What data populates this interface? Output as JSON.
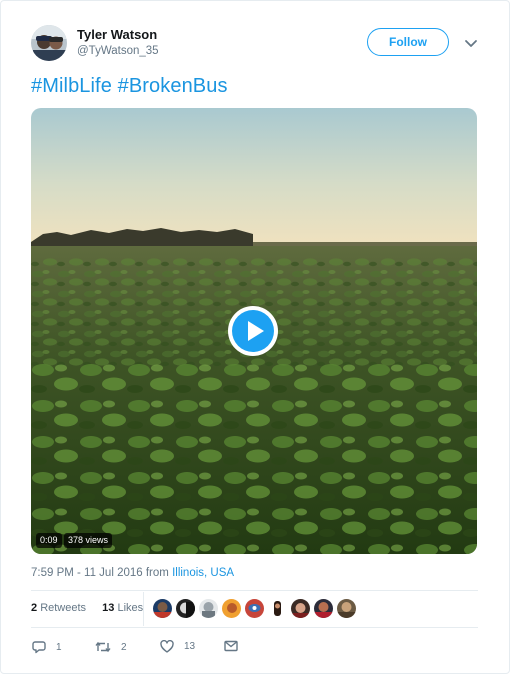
{
  "author": {
    "name": "Tyler Watson",
    "handle": "@TyWatson_35"
  },
  "follow_label": "Follow",
  "tweet_text": "#MilbLife #BrokenBus",
  "video": {
    "duration": "0:09",
    "views": "378 views"
  },
  "meta": {
    "time_date": "7:59 PM - 11 Jul 2016 from",
    "location": "Illinois, USA"
  },
  "stats": {
    "retweets_count": "2",
    "retweets_label": "Retweets",
    "likes_count": "13",
    "likes_label": "Likes"
  },
  "actions": {
    "reply_count": "1",
    "retweet_count": "2",
    "like_count": "13"
  },
  "icons": {
    "reply": "reply-icon",
    "retweet": "retweet-icon",
    "like": "heart-icon",
    "dm": "envelope-icon",
    "caret": "chevron-down-icon",
    "play": "play-icon"
  },
  "colors": {
    "accent": "#1da1f2",
    "link": "#1b95e0",
    "muted": "#657786"
  }
}
